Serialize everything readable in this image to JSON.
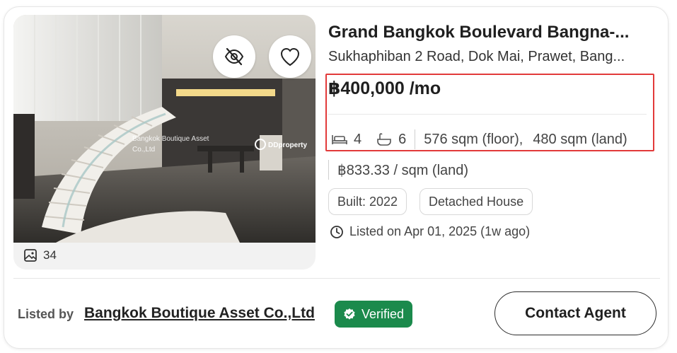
{
  "listing": {
    "title": "Grand Bangkok Boulevard Bangna-...",
    "address": "Sukhaphiban 2 Road, Dok Mai, Prawet, Bang...",
    "price": "฿400,000 /mo",
    "bedrooms": "4",
    "bathrooms": "6",
    "floor_area": "576 sqm (floor),",
    "land_area": "480 sqm (land)",
    "price_per_sqm": "฿833.33 / sqm (land)",
    "built": "Built: 2022",
    "property_type": "Detached House",
    "listed_on": "Listed on Apr 01, 2025 (1w ago)"
  },
  "media": {
    "image_count": "34",
    "watermark_agency": "Bangkok Boutique Asset Co.,Ltd",
    "watermark_brand": "DDproperty"
  },
  "footer": {
    "listed_by_label": "Listed by",
    "agent_name": "Bangkok Boutique Asset Co.,Ltd",
    "verified_label": "Verified",
    "contact_label": "Contact Agent"
  },
  "colors": {
    "highlight_border": "#e23a3a",
    "verified_bg": "#1b8a4c"
  }
}
